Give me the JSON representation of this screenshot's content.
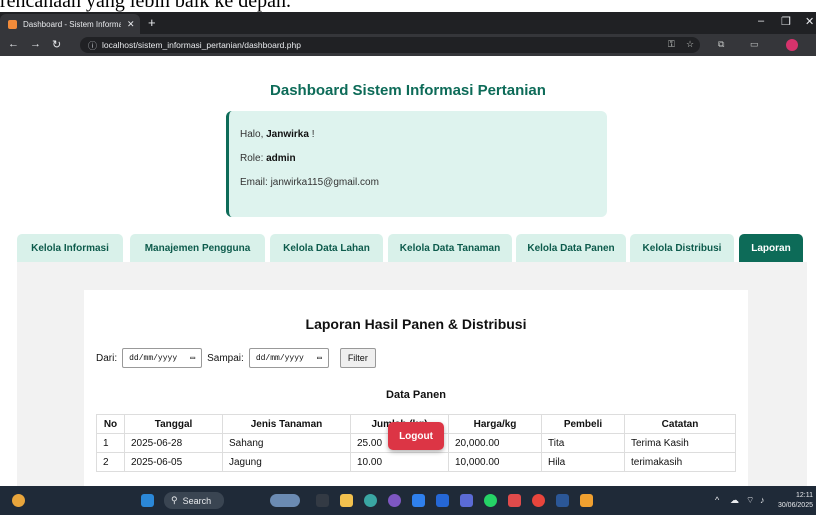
{
  "doc_fragment": "rencanaan yang lebih baik ke depan.",
  "browser": {
    "tab_title": "Dashboard - Sistem Informasi P",
    "url": "localhost/sistem_informasi_pertanian/dashboard.php"
  },
  "page": {
    "title": "Dashboard Sistem Informasi Pertanian",
    "greeting_prefix": "Halo, ",
    "user_name": "Janwirka",
    "greeting_suffix": " !",
    "role_label": "Role: ",
    "role_value": "admin",
    "email_label": "Email: ",
    "email_value": "janwirka115@gmail.com"
  },
  "nav_tabs": [
    {
      "label": "Kelola Informasi",
      "active": false
    },
    {
      "label": "Manajemen Pengguna",
      "active": false
    },
    {
      "label": "Kelola Data Lahan",
      "active": false
    },
    {
      "label": "Kelola Data Tanaman",
      "active": false
    },
    {
      "label": "Kelola Data Panen",
      "active": false
    },
    {
      "label": "Kelola Distribusi",
      "active": false
    },
    {
      "label": "Laporan",
      "active": true
    }
  ],
  "report": {
    "title": "Laporan Hasil Panen & Distribusi",
    "from_label": "Dari:",
    "to_label": "Sampai:",
    "date_placeholder": "dd/mm/yyyy",
    "filter_button": "Filter",
    "section_title": "Data Panen",
    "columns": [
      "No",
      "Tanggal",
      "Jenis Tanaman",
      "Jumlah (kg)",
      "Harga/kg",
      "Pembeli",
      "Catatan"
    ],
    "rows": [
      [
        "1",
        "2025-06-28",
        "Sahang",
        "25.00",
        "20,000.00",
        "Tita",
        "Terima Kasih"
      ],
      [
        "2",
        "2025-06-05",
        "Jagung",
        "10.00",
        "10,000.00",
        "Hila",
        "terimakasih"
      ]
    ]
  },
  "logout_button": "Logout",
  "taskbar": {
    "search_label": "Search",
    "time": "12:11",
    "date": "30/06/2025"
  },
  "colors": {
    "brand_green": "#0d6b58",
    "tab_bg": "#d9f1ea",
    "card_bg": "#def3ee",
    "logout_red": "#dc3545"
  }
}
